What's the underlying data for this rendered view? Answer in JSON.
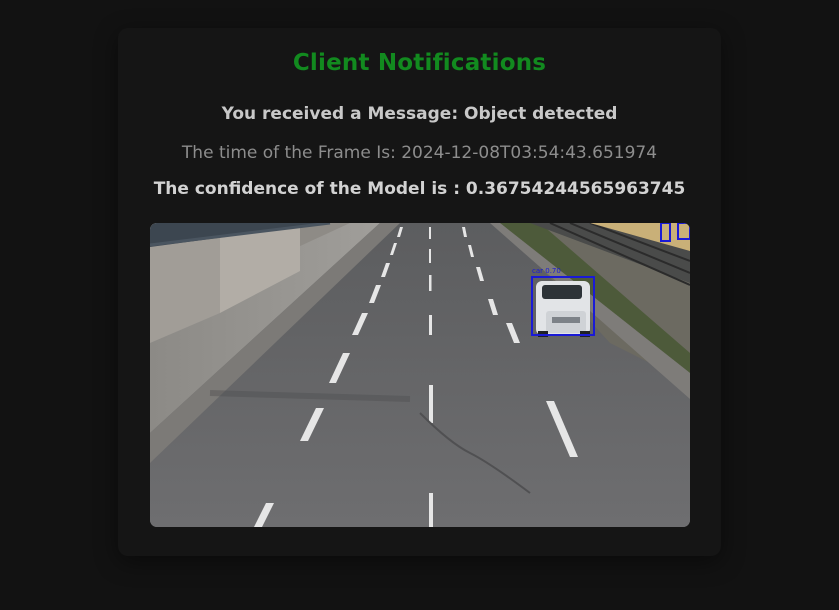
{
  "page": {
    "title": "Client Notifications",
    "message": "You received a Message: Object detected",
    "frame_time": "The time of the Frame Is: 2024-12-08T03:54:43.651974",
    "confidence": "The confidence of the Model is : 0.36754244565963745"
  },
  "detection": {
    "label": "car 0.70",
    "box_color": "#1a1ad6"
  },
  "colors": {
    "accent": "#128a1f",
    "background": "#121212",
    "card": "#151515"
  }
}
